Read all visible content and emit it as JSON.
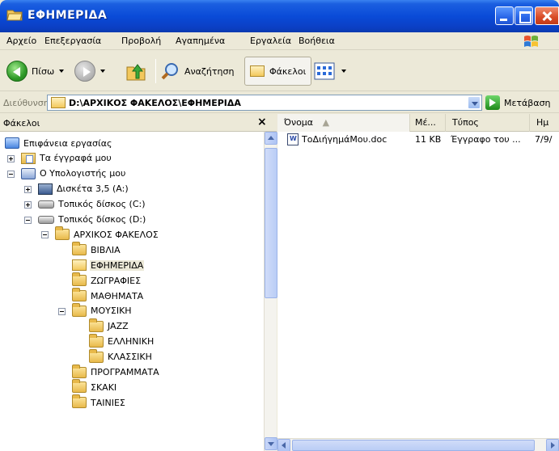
{
  "window": {
    "title": "ΕΦΗΜΕΡΙΔΑ"
  },
  "menu": [
    "Αρχείο",
    "Επεξεργασία",
    "Προβολή",
    "Αγαπημένα",
    "Εργαλεία",
    "Βοήθεια"
  ],
  "toolbar": {
    "back_label": "Πίσω",
    "search_label": "Αναζήτηση",
    "folders_label": "Φάκελοι"
  },
  "address": {
    "label": "Διεύθυνση",
    "value": "D:\\ΑΡΧΙΚΟΣ ΦΑΚΕΛΟΣ\\ΕΦΗΜΕΡΙΔΑ",
    "go_label": "Μετάβαση"
  },
  "folders_pane": {
    "title": "Φάκελοι",
    "close_glyph": "×",
    "tree": [
      {
        "label": "Επιφάνεια εργασίας",
        "icon": "desktop-icon",
        "level": 0,
        "toggle": "none"
      },
      {
        "label": "Τα έγγραφά μου",
        "icon": "my-documents-icon",
        "level": 1,
        "toggle": "plus"
      },
      {
        "label": "Ο Υπολογιστής μου",
        "icon": "my-computer-icon",
        "level": 1,
        "toggle": "minus"
      },
      {
        "label": "Δισκέτα 3,5 (A:)",
        "icon": "floppy-icon",
        "level": 2,
        "toggle": "plus"
      },
      {
        "label": "Τοπικός δίσκος (C:)",
        "icon": "drive-icon",
        "level": 2,
        "toggle": "plus"
      },
      {
        "label": "Τοπικός δίσκος (D:)",
        "icon": "drive-icon",
        "level": 2,
        "toggle": "minus"
      },
      {
        "label": "ΑΡΧΙΚΟΣ ΦΑΚΕΛΟΣ",
        "icon": "folder-icon",
        "level": 3,
        "toggle": "minus"
      },
      {
        "label": "ΒΙΒΛΙΑ",
        "icon": "folder-icon",
        "level": 4,
        "toggle": "none"
      },
      {
        "label": "ΕΦΗΜΕΡΙΔΑ",
        "icon": "open-folder-icon",
        "level": 4,
        "toggle": "none",
        "selected": true
      },
      {
        "label": "ΖΩΓΡΑΦΙΕΣ",
        "icon": "folder-icon",
        "level": 4,
        "toggle": "none"
      },
      {
        "label": "ΜΑΘΗΜΑΤΑ",
        "icon": "folder-icon",
        "level": 4,
        "toggle": "none"
      },
      {
        "label": "ΜΟΥΣΙΚΗ",
        "icon": "folder-icon",
        "level": 4,
        "toggle": "minus"
      },
      {
        "label": "JAZZ",
        "icon": "folder-icon",
        "level": 5,
        "toggle": "none"
      },
      {
        "label": "ΕΛΛΗΝΙΚΗ",
        "icon": "folder-icon",
        "level": 5,
        "toggle": "none"
      },
      {
        "label": "ΚΛΑΣΣΙΚΗ",
        "icon": "folder-icon",
        "level": 5,
        "toggle": "none"
      },
      {
        "label": "ΠΡΟΓΡΑΜΜΑΤΑ",
        "icon": "folder-icon",
        "level": 4,
        "toggle": "none"
      },
      {
        "label": "ΣΚΑΚΙ",
        "icon": "folder-icon",
        "level": 4,
        "toggle": "none"
      },
      {
        "label": "ΤΑΙΝΙΕΣ",
        "icon": "folder-icon",
        "level": 4,
        "toggle": "none"
      }
    ]
  },
  "file_list": {
    "columns": [
      "Όνομα",
      "Μέ...",
      "Τύπος",
      "Ημ"
    ],
    "files": [
      {
        "name": "ΤοΔιήγημάΜου.doc",
        "size": "11 KB",
        "type": "Έγγραφο του ...",
        "date": "7/9/"
      }
    ]
  },
  "colors": {
    "title_bar": "#0a4bd8",
    "window_bg": "#ece9d8",
    "selection_bg": "#ece9d8"
  }
}
